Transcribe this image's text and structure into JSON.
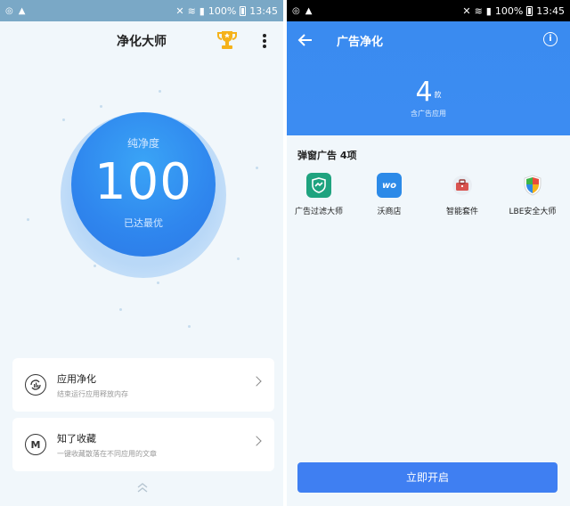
{
  "status_bar": {
    "battery": "100%",
    "time": "13:45"
  },
  "left_screen": {
    "title": "净化大师",
    "gauge": {
      "label": "纯净度",
      "value": "100",
      "sub": "已达最优"
    },
    "cards": [
      {
        "title": "应用净化",
        "subtitle": "结束运行应用释放内存",
        "icon_glyph": ""
      },
      {
        "title": "知了收藏",
        "subtitle": "一键收藏散落在不同应用的文章",
        "icon_glyph": "M"
      }
    ]
  },
  "right_screen": {
    "title": "广告净化",
    "count": "4",
    "count_unit": "款",
    "count_sub": "含广告应用",
    "section_title": "弹窗广告 4项",
    "apps": [
      {
        "name": "广告过滤大师",
        "icon": "shield-app-icon",
        "color": "#1fa37f"
      },
      {
        "name": "沃商店",
        "icon": "wo-store-icon",
        "color": "#2c8ae8",
        "icon_text": "wo"
      },
      {
        "name": "智能套件",
        "icon": "toolbox-icon",
        "color": "#d9534f"
      },
      {
        "name": "LBE安全大师",
        "icon": "lbe-shield-icon",
        "color": "#3db54a"
      }
    ],
    "button": "立即开启"
  },
  "colors": {
    "accent": "#3f7ff2",
    "gauge": "#2f86ee"
  }
}
